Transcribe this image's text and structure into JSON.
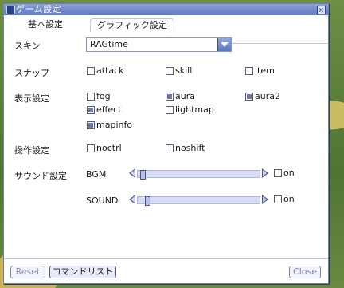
{
  "window": {
    "title": "ゲーム設定",
    "close_glyph": "×"
  },
  "tabs": [
    {
      "label": "基本設定",
      "active": true
    },
    {
      "label": "グラフィック設定",
      "active": false
    }
  ],
  "skin": {
    "label": "スキン",
    "value": "RAGtime"
  },
  "snap": {
    "label": "スナップ",
    "options": [
      {
        "label": "attack",
        "checked": false
      },
      {
        "label": "skill",
        "checked": false
      },
      {
        "label": "item",
        "checked": false
      }
    ]
  },
  "display": {
    "label": "表示設定",
    "options": [
      {
        "label": "fog",
        "checked": false
      },
      {
        "label": "aura",
        "checked": true
      },
      {
        "label": "aura2",
        "checked": true
      },
      {
        "label": "effect",
        "checked": true
      },
      {
        "label": "lightmap",
        "checked": false
      },
      {
        "label": "mapinfo",
        "checked": true
      }
    ]
  },
  "control": {
    "label": "操作設定",
    "options": [
      {
        "label": "noctrl",
        "checked": false
      },
      {
        "label": "noshift",
        "checked": false
      }
    ]
  },
  "sound": {
    "label": "サウンド設定",
    "bgm": {
      "label": "BGM",
      "level": 0.04,
      "on_label": "on",
      "on_checked": false
    },
    "se": {
      "label": "SOUND",
      "level": 0.08,
      "on_label": "on",
      "on_checked": false
    }
  },
  "footer": {
    "reset_label": "Reset",
    "commands_label": "コマンドリスト",
    "close_label": "Close"
  }
}
